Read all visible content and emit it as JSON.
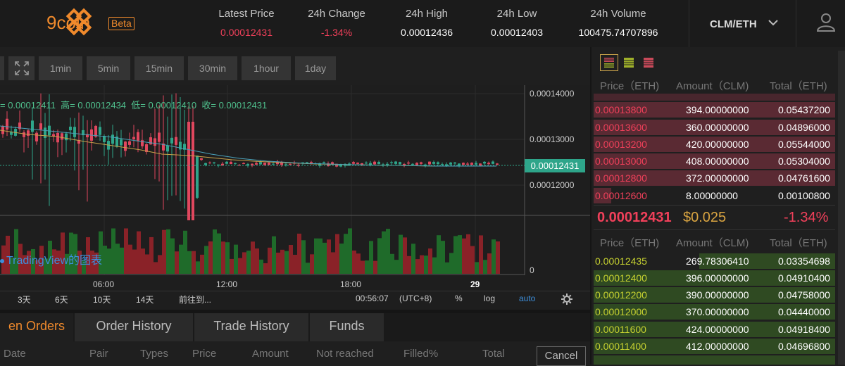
{
  "brand": {
    "name": "9coin",
    "tag": "Beta"
  },
  "stats": [
    {
      "label": "Latest Price",
      "value": "0.00012431",
      "red": true
    },
    {
      "label": "24h Change",
      "value": "-1.34%",
      "red": true
    },
    {
      "label": "24h High",
      "value": "0.00012436",
      "red": false
    },
    {
      "label": "24h Low",
      "value": "0.00012403",
      "red": false
    },
    {
      "label": "24h Volume",
      "value": "100475.74707896",
      "red": false
    }
  ],
  "pair": "CLM/ETH",
  "toolbar": {
    "intervals": [
      "1min",
      "5min",
      "15min",
      "30min",
      "1hour",
      "1day"
    ]
  },
  "chart": {
    "ohlc_text": "= 0.00012411  高= 0.00012434  低= 0.00012410  收= 0.00012431",
    "watermark": "TradingView的图表",
    "y_labels": [
      "0.00014000",
      "0.00013000",
      "0.00012000"
    ],
    "price_tag": "0.00012431",
    "vol_zero": "0",
    "x_labels": [
      "06:00",
      "12:00",
      "18:00",
      "29"
    ],
    "bottom": {
      "ranges": [
        "3天",
        "6天",
        "10天",
        "14天"
      ],
      "goto": "前往到...",
      "clock": "00:56:07",
      "tz": "(UTC+8)",
      "pct": "%",
      "log": "log",
      "auto": "auto"
    }
  },
  "orders": {
    "tabs": [
      "en Orders",
      "Order History",
      "Trade History",
      "Funds"
    ],
    "columns": [
      "Date",
      "Pair",
      "Types",
      "Price",
      "Amount",
      "Not reached",
      "Filled%",
      "Total"
    ],
    "cancel": "Cancel"
  },
  "book": {
    "headers": [
      "Price（ETH)",
      "Amount（CLM)",
      "Total（ETH)"
    ],
    "asks": [
      {
        "price": "0.00013800",
        "amount": "394.00000000",
        "total": "0.05437200"
      },
      {
        "price": "0.00013600",
        "amount": "360.00000000",
        "total": "0.04896000"
      },
      {
        "price": "0.00013200",
        "amount": "420.00000000",
        "total": "0.05544000"
      },
      {
        "price": "0.00013000",
        "amount": "408.00000000",
        "total": "0.05304000"
      },
      {
        "price": "0.00012800",
        "amount": "372.00000000",
        "total": "0.04761600"
      },
      {
        "price": "0.00012600",
        "amount": "8.00000000",
        "total": "0.00100800"
      }
    ],
    "mid": {
      "price": "0.00012431",
      "usd": "$0.025",
      "change": "-1.34%"
    },
    "bids": [
      {
        "price": "0.00012435",
        "amount": "269.78306410",
        "total": "0.03354698"
      },
      {
        "price": "0.00012400",
        "amount": "396.00000000",
        "total": "0.04910400"
      },
      {
        "price": "0.00012200",
        "amount": "390.00000000",
        "total": "0.04758000"
      },
      {
        "price": "0.00012000",
        "amount": "370.00000000",
        "total": "0.04440000"
      },
      {
        "price": "0.00011600",
        "amount": "424.00000000",
        "total": "0.04918400"
      },
      {
        "price": "0.00011400",
        "amount": "412.00000000",
        "total": "0.04696800"
      }
    ]
  }
}
